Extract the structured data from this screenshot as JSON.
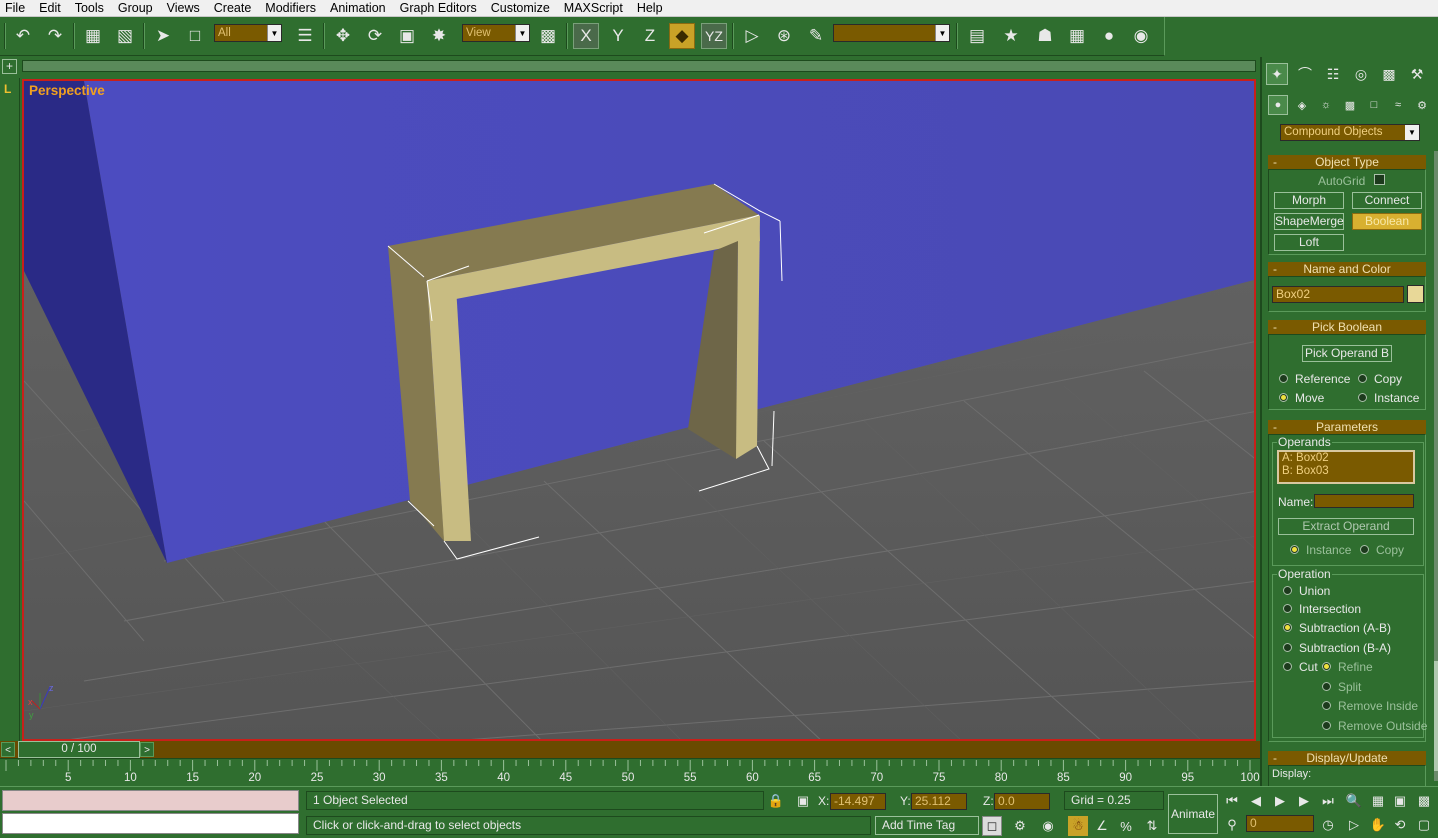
{
  "menu": [
    "File",
    "Edit",
    "Tools",
    "Group",
    "Views",
    "Create",
    "Modifiers",
    "Animation",
    "Graph Editors",
    "Customize",
    "MAXScript",
    "Help"
  ],
  "toolbar": {
    "selection_filter": "All",
    "ref_coord": "View",
    "axis_x": "X",
    "axis_y": "Y",
    "axis_z": "Z",
    "axis_yz": "YZ",
    "named_selection": ""
  },
  "viewport": {
    "label": "Perspective",
    "left_strip_label": "L"
  },
  "frame_slider": {
    "value": "0 / 100",
    "prev": "<",
    "next": ">"
  },
  "timeline": {
    "ticks": [
      "5",
      "10",
      "15",
      "20",
      "25",
      "30",
      "35",
      "40",
      "45",
      "50",
      "55",
      "60",
      "65",
      "70",
      "75",
      "80",
      "85",
      "90",
      "95",
      "100"
    ]
  },
  "status": {
    "selection": "1 Object Selected",
    "prompt": "Click or click-and-drag to select objects",
    "x_label": "X:",
    "x_value": "-14.497",
    "y_label": "Y:",
    "y_value": "25.112",
    "z_label": "Z:",
    "z_value": "0.0",
    "grid": "Grid = 0.25",
    "add_time_tag": "Add Time Tag",
    "animate": "Animate",
    "frame_field": "0"
  },
  "command_panel": {
    "category": "Compound Objects",
    "object_type": {
      "title": "Object Type",
      "autogrid": "AutoGrid",
      "buttons": [
        "Morph",
        "Connect",
        "ShapeMerge",
        "Boolean",
        "Loft"
      ]
    },
    "name_and_color": {
      "title": "Name and Color",
      "name": "Box02"
    },
    "pick_boolean": {
      "title": "Pick Boolean",
      "button": "Pick Operand B",
      "reference": "Reference",
      "copy": "Copy",
      "move": "Move",
      "instance": "Instance"
    },
    "parameters": {
      "title": "Parameters",
      "operands_label": "Operands",
      "operand_a": "A: Box02",
      "operand_b": "B: Box03",
      "name_label": "Name:",
      "extract": "Extract Operand",
      "instance": "Instance",
      "copy": "Copy",
      "operation_label": "Operation",
      "union": "Union",
      "intersection": "Intersection",
      "sub_ab": "Subtraction (A-B)",
      "sub_ba": "Subtraction (B-A)",
      "cut": "Cut",
      "refine": "Refine",
      "split": "Split",
      "remove_inside": "Remove Inside",
      "remove_outside": "Remove Outside"
    },
    "display_update": {
      "title": "Display/Update",
      "display": "Display:"
    }
  },
  "colors": {
    "ui_green": "#2f6e2f",
    "field_brown": "#7a5a00",
    "active_yellow": "#d8b030",
    "viewport_border": "#c8201a",
    "wall_blue": "#4848b8",
    "floor_gray": "#5b5b5b",
    "frame_tan": "#c8bc82"
  }
}
